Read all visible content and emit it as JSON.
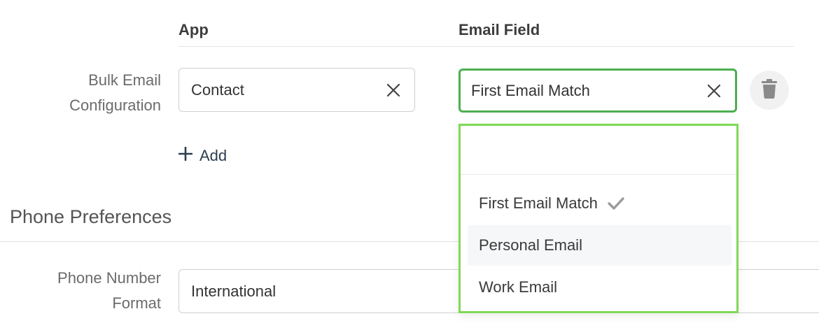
{
  "table": {
    "col_app": "App",
    "col_email_field": "Email Field"
  },
  "bulk_email": {
    "label_line1": "Bulk Email",
    "label_line2": "Configuration",
    "app_value": "Contact",
    "email_field_value": "First Email Match",
    "add_label": "Add"
  },
  "dropdown": {
    "search_value": "",
    "options": [
      {
        "label": "First Email Match",
        "selected": true
      },
      {
        "label": "Personal Email",
        "selected": false
      },
      {
        "label": "Work Email",
        "selected": false
      }
    ]
  },
  "phone_preferences": {
    "section_title": "Phone Preferences",
    "format_label_line1": "Phone Number",
    "format_label_line2": "Format",
    "format_value": "International"
  },
  "colors": {
    "focus_border": "#4caf50",
    "dropdown_border": "#7ed957",
    "text": "#333333",
    "muted_label": "#6b6b6b"
  }
}
